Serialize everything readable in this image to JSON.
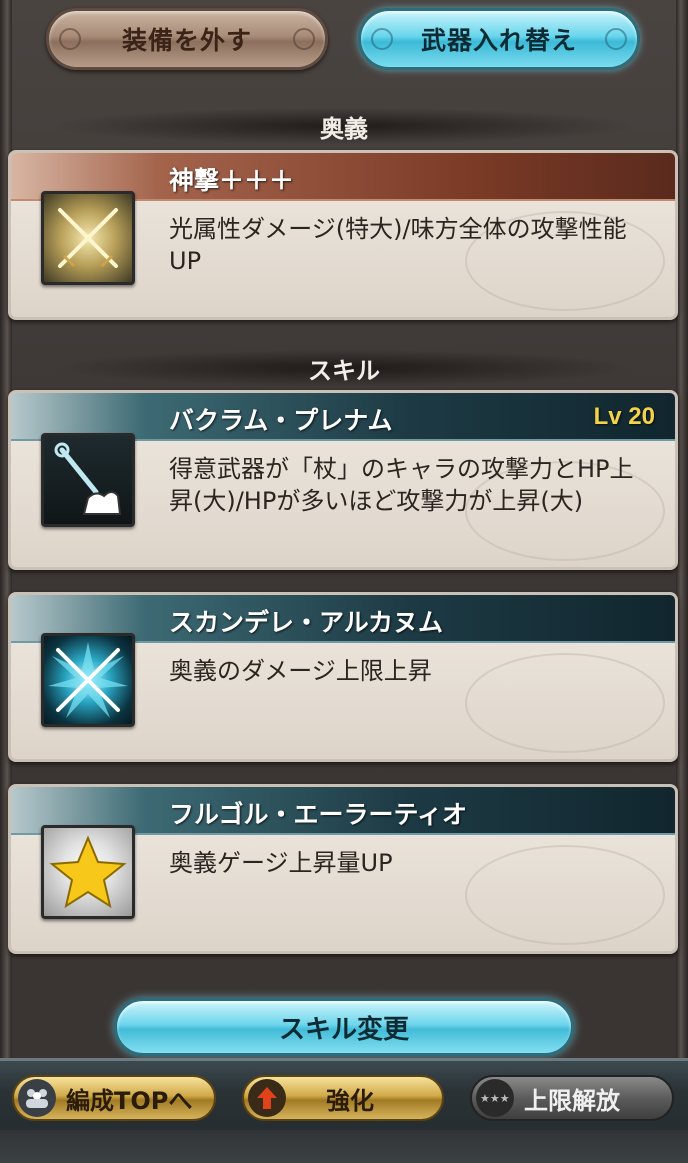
{
  "top_buttons": {
    "remove_label": "装備を外す",
    "swap_label": "武器入れ替え"
  },
  "sections": {
    "ougi_header": "奥義",
    "skill_header": "スキル"
  },
  "ougi": {
    "title": "神撃＋＋＋",
    "description": "光属性ダメージ(特大)/味方全体の攻撃性能UP",
    "icon": "crossed-swords-light-icon"
  },
  "skills": [
    {
      "title": "バクラム・プレナム",
      "level": "Lv 20",
      "description": "得意武器が「杖」のキャラの攻撃力とHP上昇(大)/HPが多いほど攻撃力が上昇(大)",
      "icon": "staff-arm-icon"
    },
    {
      "title": "スカンデレ・アルカヌム",
      "description": "奥義のダメージ上限上昇",
      "icon": "crossed-swords-burst-icon"
    },
    {
      "title": "フルゴル・エーラーティオ",
      "description": "奥義ゲージ上昇量UP",
      "icon": "star-icon"
    }
  ],
  "skill_change_label": "スキル変更",
  "bottom_bar": {
    "party_top_label": "編成TOPへ",
    "enhance_label": "強化",
    "limit_break_label": "上限解放"
  },
  "colors": {
    "level": "#f3d34a",
    "ougi_bar": "#7a3a26",
    "skill_bar": "#1d3a44",
    "accent_button": "#6ed6ec"
  }
}
